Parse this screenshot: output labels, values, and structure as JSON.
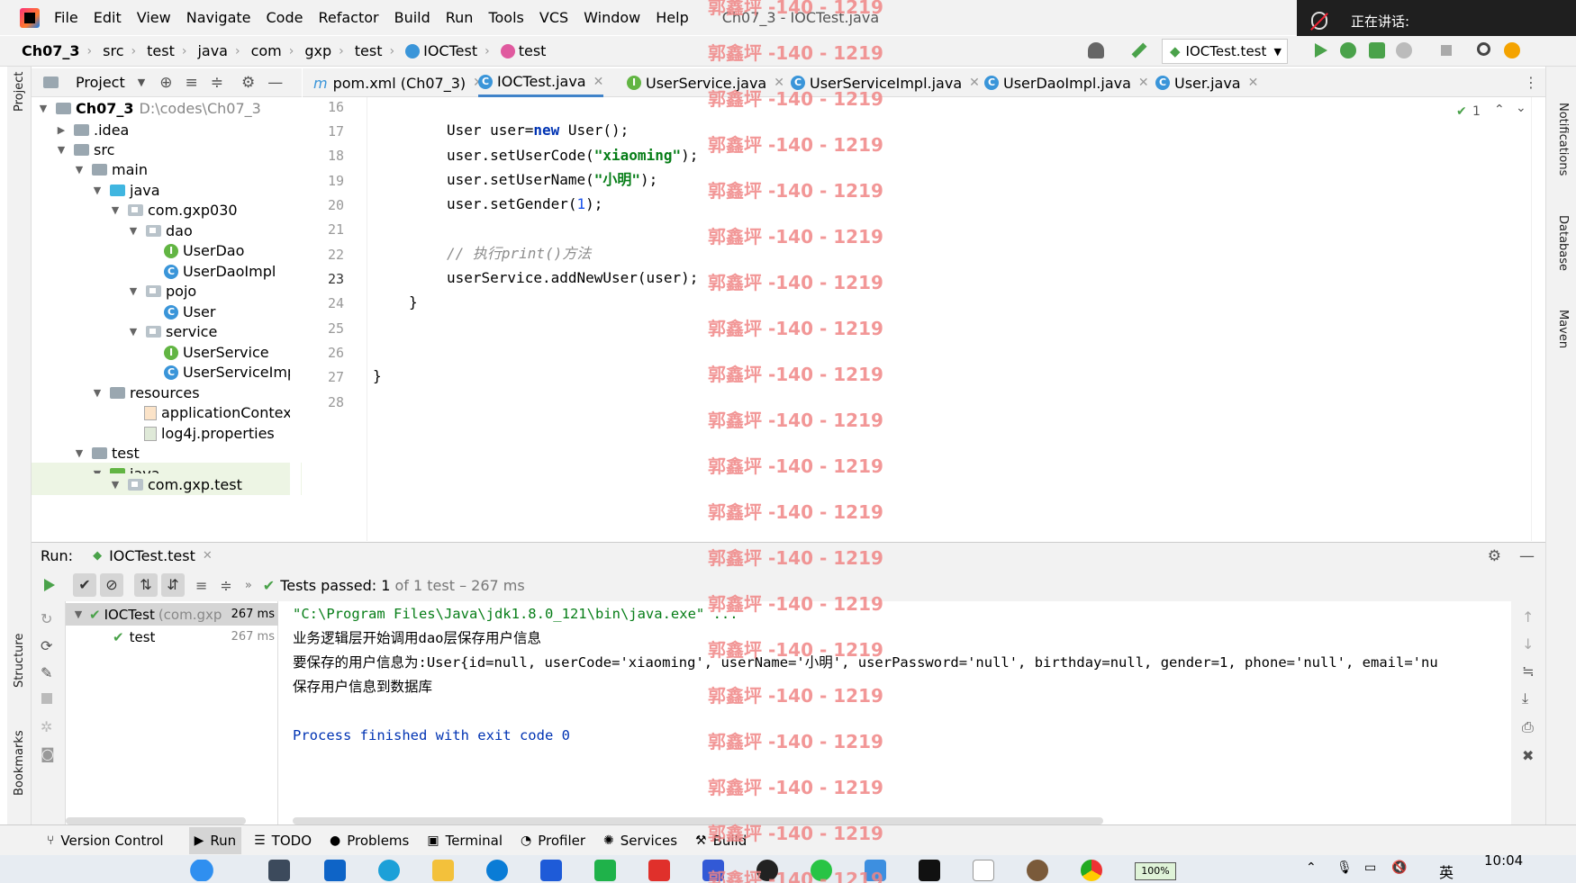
{
  "menubar": {
    "items": [
      "File",
      "Edit",
      "View",
      "Navigate",
      "Code",
      "Refactor",
      "Build",
      "Run",
      "Tools",
      "VCS",
      "Window",
      "Help"
    ],
    "window_title": "Ch07_3 - IOCTest.java"
  },
  "meeting": {
    "status": "正在讲话:"
  },
  "breadcrumb": {
    "items": [
      "Ch07_3",
      "src",
      "test",
      "java",
      "com",
      "gxp",
      "test",
      "IOCTest",
      "test"
    ]
  },
  "run_config": {
    "label": "IOCTest.test"
  },
  "project_panel": {
    "title": "Project",
    "tree": [
      {
        "label": "Ch07_3",
        "extra": "D:\\codes\\Ch07_3"
      },
      {
        "label": ".idea"
      },
      {
        "label": "src"
      },
      {
        "label": "main"
      },
      {
        "label": "java"
      },
      {
        "label": "com.gxp030"
      },
      {
        "label": "dao"
      },
      {
        "label": "UserDao"
      },
      {
        "label": "UserDaoImpl"
      },
      {
        "label": "pojo"
      },
      {
        "label": "User"
      },
      {
        "label": "service"
      },
      {
        "label": "UserService"
      },
      {
        "label": "UserServiceImp"
      },
      {
        "label": "resources"
      },
      {
        "label": "applicationContext.xr"
      },
      {
        "label": "log4j.properties"
      },
      {
        "label": "test"
      },
      {
        "label": "java"
      },
      {
        "label": "com.gxp.test"
      }
    ]
  },
  "editor": {
    "tabs": [
      {
        "label": "pom.xml (Ch07_3)"
      },
      {
        "label": "IOCTest.java"
      },
      {
        "label": "UserService.java"
      },
      {
        "label": "UserServiceImpl.java"
      },
      {
        "label": "UserDaoImpl.java"
      },
      {
        "label": "User.java"
      }
    ],
    "line_numbers": [
      "16",
      "17",
      "18",
      "19",
      "20",
      "21",
      "22",
      "23",
      "24",
      "25",
      "26",
      "27",
      "28"
    ],
    "code": {
      "l17a": "User user=",
      "l17b": "new",
      "l17c": " User();",
      "l18a": "user.setUserCode(",
      "l18b": "\"xiaoming\"",
      "l18c": ");",
      "l19a": "user.setUserName(",
      "l19b": "\"小明\"",
      "l19c": ");",
      "l20a": "user.setGender(",
      "l20b": "1",
      "l20c": ");",
      "l22": "// 执行print()方法",
      "l23": "userService.addNewUser(user);",
      "l24": "}",
      "l27": "}"
    },
    "inspection": "1"
  },
  "run_panel": {
    "label": "Run:",
    "tab": "IOCTest.test",
    "status_prefix": "Tests passed: ",
    "status_count": "1",
    "status_suffix": " of 1 test – 267 ms",
    "tree": [
      {
        "label": "IOCTest",
        "pkg": "(com.gxp",
        "time": "267 ms"
      },
      {
        "label": "test",
        "time": "267 ms"
      }
    ],
    "console": [
      "\"C:\\Program Files\\Java\\jdk1.8.0_121\\bin\\java.exe\" ...",
      "业务逻辑层开始调用dao层保存用户信息",
      "要保存的用户信息为:User{id=null, userCode='xiaoming', userName='小明', userPassword='null', birthday=null, gender=1, phone='null', email='nu",
      "保存用户信息到数据库",
      "",
      "Process finished with exit code 0"
    ]
  },
  "left_strip": {
    "project": "Project",
    "structure": "Structure",
    "bookmarks": "Bookmarks"
  },
  "right_strip": {
    "notifications": "Notifications",
    "database": "Database",
    "maven": "Maven"
  },
  "bottom_bar": {
    "items": [
      "Version Control",
      "Run",
      "TODO",
      "Problems",
      "Terminal",
      "Profiler",
      "Services",
      "Build"
    ]
  },
  "taskbar": {
    "time": "10:04",
    "lang": "英",
    "battery": "100%"
  },
  "watermark": {
    "text": "郭鑫坪 -140 - 1219"
  },
  "colors": {
    "accent": "#4083c9",
    "pass": "#4aa24a",
    "keyword": "#0033b3",
    "string": "#067d17",
    "number": "#1750eb",
    "watermark": "#f08585"
  }
}
